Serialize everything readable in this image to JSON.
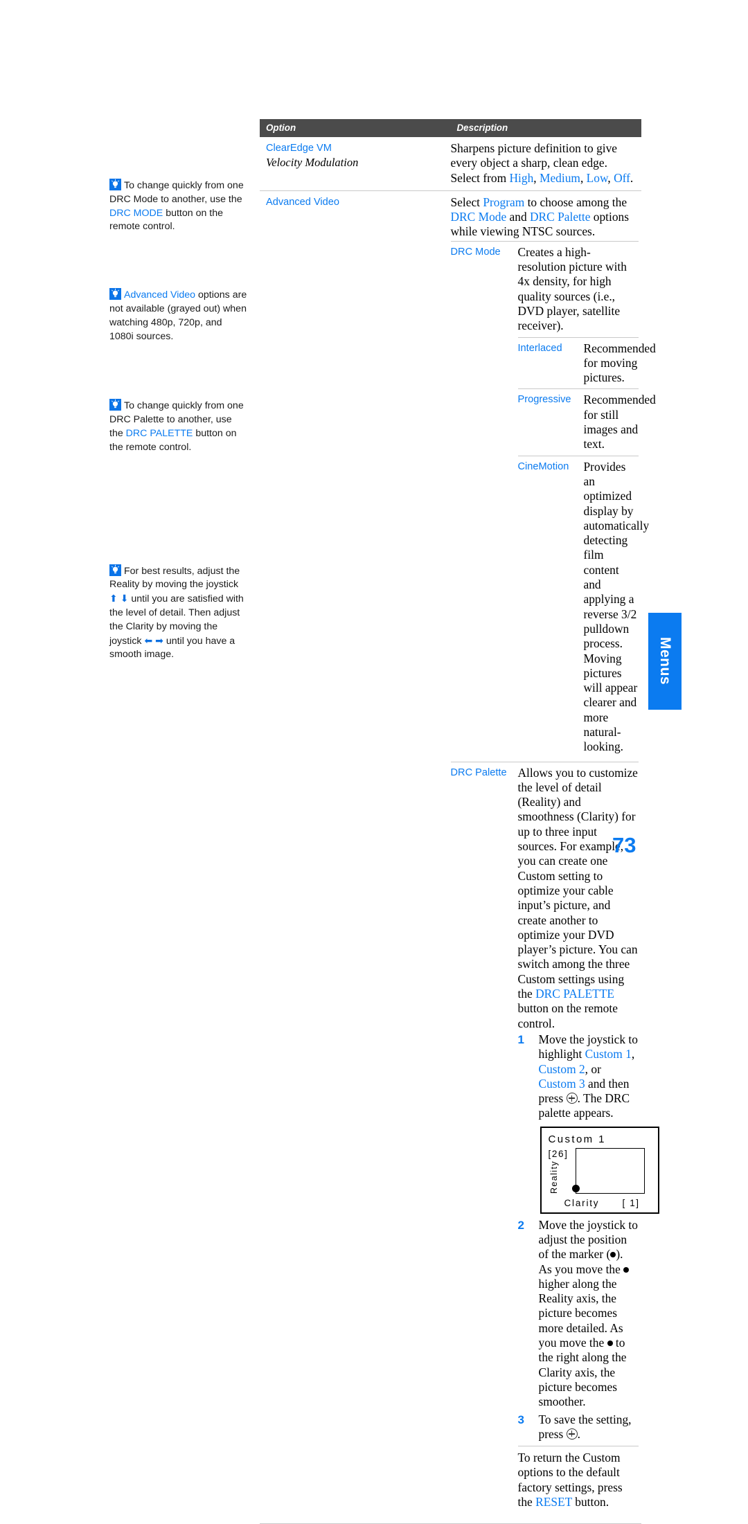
{
  "page": {
    "number": "73",
    "tab_label": "Menus",
    "accent_color": "#0b7bf0",
    "header_bg_color": "#4b4b4b"
  },
  "sidenotes": [
    {
      "icon": "tip-lightbulb-icon",
      "segments": [
        {
          "text": "To change quickly from one DRC Mode to another, use the ",
          "style": "plain"
        },
        {
          "text": "DRC MODE",
          "style": "keyword"
        },
        {
          "text": " button on the remote control.",
          "style": "plain"
        }
      ]
    },
    {
      "icon": "tip-lightbulb-icon",
      "segments": [
        {
          "text": "Advanced Video",
          "style": "keyword"
        },
        {
          "text": " options are not available (grayed out) when watching 480p, 720p, and 1080i sources.",
          "style": "plain"
        }
      ]
    },
    {
      "icon": "tip-lightbulb-icon",
      "segments": [
        {
          "text": "To change quickly from one DRC Palette to another, use the ",
          "style": "plain"
        },
        {
          "text": "DRC PALETTE",
          "style": "keyword"
        },
        {
          "text": " button on the remote control.",
          "style": "plain"
        }
      ]
    },
    {
      "icon": "tip-lightbulb-icon",
      "segments": [
        {
          "text": "For best results, adjust the Reality by moving the joystick ",
          "style": "plain"
        },
        {
          "text": "⬆",
          "style": "arrow"
        },
        {
          "text": " ",
          "style": "plain"
        },
        {
          "text": "⬇",
          "style": "arrow"
        },
        {
          "text": " until you are satisfied with the level of detail. Then adjust the Clarity by moving the joystick ",
          "style": "plain"
        },
        {
          "text": "⬅",
          "style": "arrow"
        },
        {
          "text": " ",
          "style": "plain"
        },
        {
          "text": "➡",
          "style": "arrow"
        },
        {
          "text": " until you have a smooth image.",
          "style": "plain"
        }
      ]
    }
  ],
  "table": {
    "headers": {
      "option": "Option",
      "description": "Description"
    },
    "rows": [
      {
        "option_main": "ClearEdge VM",
        "option_italic": "Velocity Modulation",
        "description_parts": [
          {
            "text": "Sharpens picture definition to give every object a sharp, clean edge. Select from ",
            "style": "plain"
          },
          {
            "text": "High",
            "style": "keyword"
          },
          {
            "text": ", ",
            "style": "plain"
          },
          {
            "text": "Medium",
            "style": "keyword"
          },
          {
            "text": ", ",
            "style": "plain"
          },
          {
            "text": "Low",
            "style": "keyword"
          },
          {
            "text": ", ",
            "style": "plain"
          },
          {
            "text": "Off",
            "style": "keyword"
          },
          {
            "text": ".",
            "style": "plain"
          }
        ]
      },
      {
        "option_main": "Advanced Video",
        "option_italic": "",
        "description_parts": [
          {
            "text": "Select ",
            "style": "plain"
          },
          {
            "text": "Program",
            "style": "keyword"
          },
          {
            "text": " to choose among the ",
            "style": "plain"
          },
          {
            "text": "DRC Mode",
            "style": "keyword"
          },
          {
            "text": " and ",
            "style": "plain"
          },
          {
            "text": "DRC Palette",
            "style": "keyword"
          },
          {
            "text": " options while viewing NTSC sources.",
            "style": "plain"
          }
        ]
      }
    ],
    "subrows": [
      {
        "label": "DRC Mode",
        "description_parts": [
          {
            "text": "Creates a high-resolution picture with 4x density, for high quality sources (i.e., DVD player, satellite receiver).",
            "style": "plain"
          }
        ],
        "children": [
          {
            "label": "Interlaced",
            "description_parts": [
              {
                "text": "Recommended for moving pictures.",
                "style": "plain"
              }
            ]
          },
          {
            "label": "Progressive",
            "description_parts": [
              {
                "text": "Recommended for still images and text.",
                "style": "plain"
              }
            ]
          },
          {
            "label": "CineMotion",
            "description_parts": [
              {
                "text": "Provides an optimized display by automatically detecting film content and applying a reverse 3/2 pulldown process. Moving pictures will appear clearer and more natural-looking.",
                "style": "plain"
              }
            ]
          }
        ]
      },
      {
        "label": "DRC Palette",
        "description_parts": [
          {
            "text": "Allows you to customize the level of detail (Reality) and smoothness (Clarity) for up to three input sources. For example, you can create one Custom setting to optimize your cable input’s picture, and create another to optimize your DVD player’s picture. You can switch among the three Custom settings using the ",
            "style": "plain"
          },
          {
            "text": "DRC PALETTE",
            "style": "keyword"
          },
          {
            "text": " button on the remote control.",
            "style": "plain"
          }
        ],
        "children": []
      }
    ]
  },
  "steps": [
    {
      "number": "1",
      "parts": [
        {
          "text": "Move the joystick to highlight ",
          "style": "plain"
        },
        {
          "text": "Custom 1",
          "style": "keyword"
        },
        {
          "text": ", ",
          "style": "plain"
        },
        {
          "text": "Custom 2",
          "style": "keyword"
        },
        {
          "text": ", or ",
          "style": "plain"
        },
        {
          "text": "Custom 3",
          "style": "keyword"
        },
        {
          "text": " and then press ",
          "style": "plain"
        },
        {
          "text": "⊕",
          "style": "circleplus"
        },
        {
          "text": ". The DRC palette appears.",
          "style": "plain"
        }
      ]
    },
    {
      "number": "2",
      "parts": [
        {
          "text": "Move the joystick to adjust the position of the marker (",
          "style": "plain"
        },
        {
          "text": "●",
          "style": "dot"
        },
        {
          "text": "). As you move the ",
          "style": "plain"
        },
        {
          "text": "●",
          "style": "dot"
        },
        {
          "text": " higher along the Reality axis, the picture becomes more detailed. As you move the ",
          "style": "plain"
        },
        {
          "text": "●",
          "style": "dot"
        },
        {
          "text": " to the right along the Clarity axis, the picture becomes smoother.",
          "style": "plain"
        }
      ]
    },
    {
      "number": "3",
      "parts": [
        {
          "text": "To save the setting, press ",
          "style": "plain"
        },
        {
          "text": "⊕",
          "style": "circleplus"
        },
        {
          "text": ".",
          "style": "plain"
        }
      ]
    }
  ],
  "osd": {
    "title": "Custom  1",
    "reality_label": "Reality",
    "reality_value": "[26]",
    "clarity_label": "Clarity",
    "clarity_value": "[ 1]"
  },
  "closing": {
    "parts": [
      {
        "text": "To return the Custom options to the default factory settings, press the ",
        "style": "plain"
      },
      {
        "text": "RESET",
        "style": "keyword"
      },
      {
        "text": " button.",
        "style": "plain"
      }
    ]
  }
}
